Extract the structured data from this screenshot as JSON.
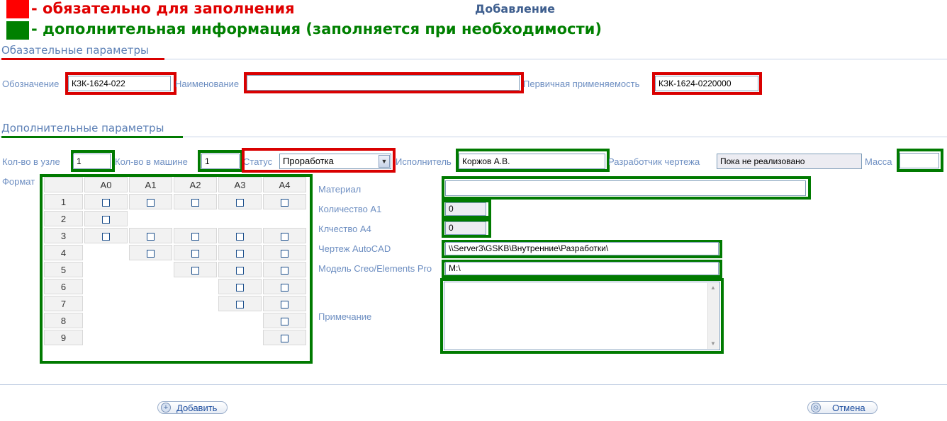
{
  "legend": {
    "required_color": "#ff0000",
    "optional_color": "#008000",
    "required_text": "- обязательно для заполнения",
    "optional_text": "- дополнительная информация (заполняется при необходимости)"
  },
  "page_title": "Добавление",
  "required_section": {
    "title": "Обазательные параметры",
    "designation_label": "Обозначение",
    "designation_value": "КЗК-1624-022",
    "name_label": "Наименование",
    "name_value": "",
    "primary_use_label": "Первичная применяемость",
    "primary_use_value": "КЗК-1624-0220000"
  },
  "optional_section": {
    "title": "Дополнительные параметры",
    "qty_node_label": "Кол-во в узле",
    "qty_node_value": "1",
    "qty_machine_label": "Кол-во в машине",
    "qty_machine_value": "1",
    "status_label": "Статус",
    "status_value": "Проработка",
    "executor_label": "Исполнитель",
    "executor_value": "Коржов А.В.",
    "developer_label": "Разработчик чертежа",
    "developer_value": "Пока не реализовано",
    "mass_label": "Масса",
    "mass_value": "",
    "format_label": "Формат",
    "format_table": {
      "columns": [
        "A0",
        "A1",
        "A2",
        "A3",
        "A4"
      ],
      "rows": [
        {
          "label": "1",
          "cells": [
            true,
            true,
            true,
            true,
            true
          ]
        },
        {
          "label": "2",
          "cells": [
            true,
            false,
            false,
            false,
            false
          ]
        },
        {
          "label": "3",
          "cells": [
            true,
            true,
            true,
            true,
            true
          ]
        },
        {
          "label": "4",
          "cells": [
            false,
            true,
            true,
            true,
            true
          ]
        },
        {
          "label": "5",
          "cells": [
            false,
            false,
            true,
            true,
            true
          ]
        },
        {
          "label": "6",
          "cells": [
            false,
            false,
            false,
            true,
            true
          ]
        },
        {
          "label": "7",
          "cells": [
            false,
            false,
            false,
            true,
            true
          ]
        },
        {
          "label": "8",
          "cells": [
            false,
            false,
            false,
            false,
            true
          ]
        },
        {
          "label": "9",
          "cells": [
            false,
            false,
            false,
            false,
            true
          ]
        }
      ]
    },
    "material_label": "Материал",
    "material_value": "",
    "qty_a1_label": "Количество А1",
    "qty_a1_value": "0",
    "qty_a4_label": "Клчество А4",
    "qty_a4_value": "0",
    "autocad_label": "Чертеж AutoCAD",
    "autocad_value": "\\\\Server3\\GSKB\\Внутренние\\Разработки\\",
    "creo_label": "Модель Creo/Elements Pro",
    "creo_value": "M:\\",
    "note_label": "Примечание",
    "note_value": ""
  },
  "buttons": {
    "add_label": "Добавить",
    "cancel_label": "Отмена"
  }
}
